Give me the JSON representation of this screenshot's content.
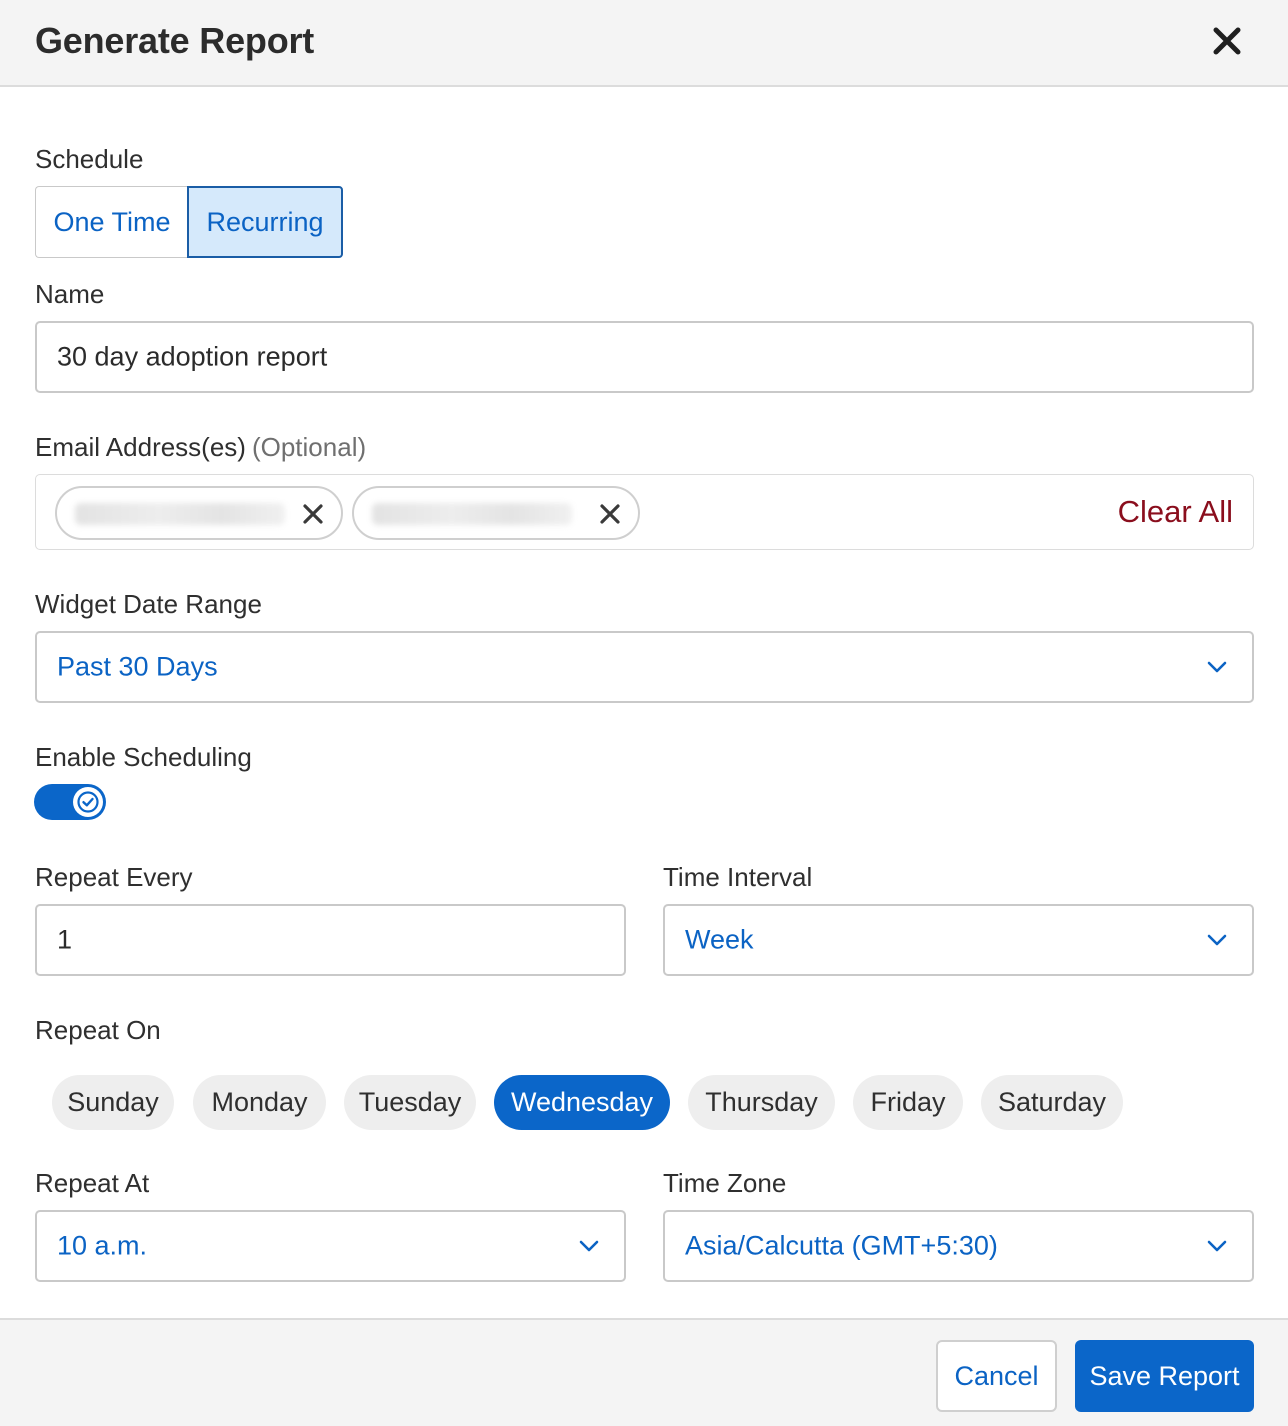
{
  "header": {
    "title": "Generate Report",
    "close_icon": "close-icon"
  },
  "schedule": {
    "label": "Schedule",
    "options": [
      "One Time",
      "Recurring"
    ],
    "selected": "Recurring"
  },
  "name": {
    "label": "Name",
    "value": "30 day adoption report"
  },
  "email": {
    "label": "Email Address(es)",
    "optional": "(Optional)",
    "clear_all": "Clear All",
    "chip_count": 2
  },
  "date_range": {
    "label": "Widget Date Range",
    "value": "Past 30 Days"
  },
  "enable_scheduling": {
    "label": "Enable Scheduling",
    "on": true
  },
  "repeat_every": {
    "label": "Repeat Every",
    "value": "1"
  },
  "time_interval": {
    "label": "Time Interval",
    "value": "Week"
  },
  "repeat_on": {
    "label": "Repeat On",
    "days": [
      "Sunday",
      "Monday",
      "Tuesday",
      "Wednesday",
      "Thursday",
      "Friday",
      "Saturday"
    ],
    "selected": "Wednesday"
  },
  "repeat_at": {
    "label": "Repeat At",
    "value": "10 a.m."
  },
  "time_zone": {
    "label": "Time Zone",
    "value": "Asia/Calcutta (GMT+5:30)"
  },
  "footer": {
    "cancel_label": "Cancel",
    "save_label": "Save Report"
  },
  "colors": {
    "accent": "#0b66c9",
    "link": "#0b63c4",
    "danger": "#8a0e1d",
    "segment_selected_bg": "#d5e9fb"
  }
}
